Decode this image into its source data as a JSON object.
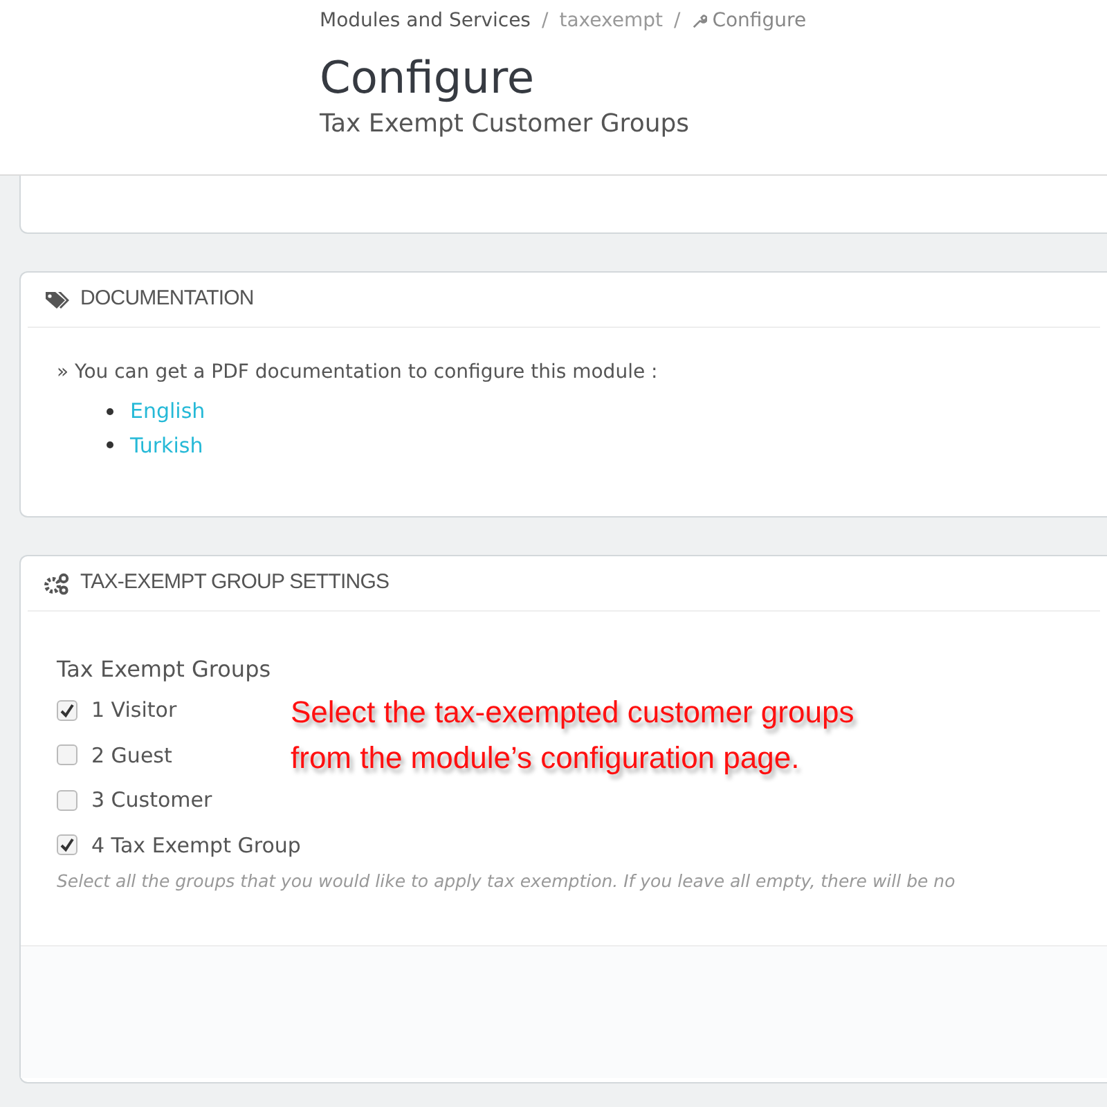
{
  "breadcrumb": [
    {
      "label": "Modules and Services",
      "kind": "link"
    },
    {
      "label": "taxexempt",
      "kind": "muted"
    },
    {
      "label": "Configure",
      "kind": "current"
    }
  ],
  "breadcrumb_separator": "/",
  "page": {
    "title": "Configure",
    "subtitle": "Tax Exempt Customer Groups"
  },
  "documentation": {
    "heading": "DOCUMENTATION",
    "intro": "» You can get a PDF documentation to configure this module :",
    "links": [
      "English",
      "Turkish"
    ]
  },
  "settings": {
    "heading": "TAX-EXEMPT GROUP SETTINGS",
    "label": "Tax Exempt Groups",
    "groups": [
      {
        "label": "1 Visitor",
        "checked": true
      },
      {
        "label": "2 Guest",
        "checked": false
      },
      {
        "label": "3 Customer",
        "checked": false
      },
      {
        "label": "4 Tax Exempt Group",
        "checked": true
      }
    ],
    "help": "Select all the groups that you would like to apply tax exemption. If you leave all empty, there will be no"
  },
  "annotation": [
    "Select the tax-exempted customer groups",
    "from the module’s configuration page."
  ]
}
